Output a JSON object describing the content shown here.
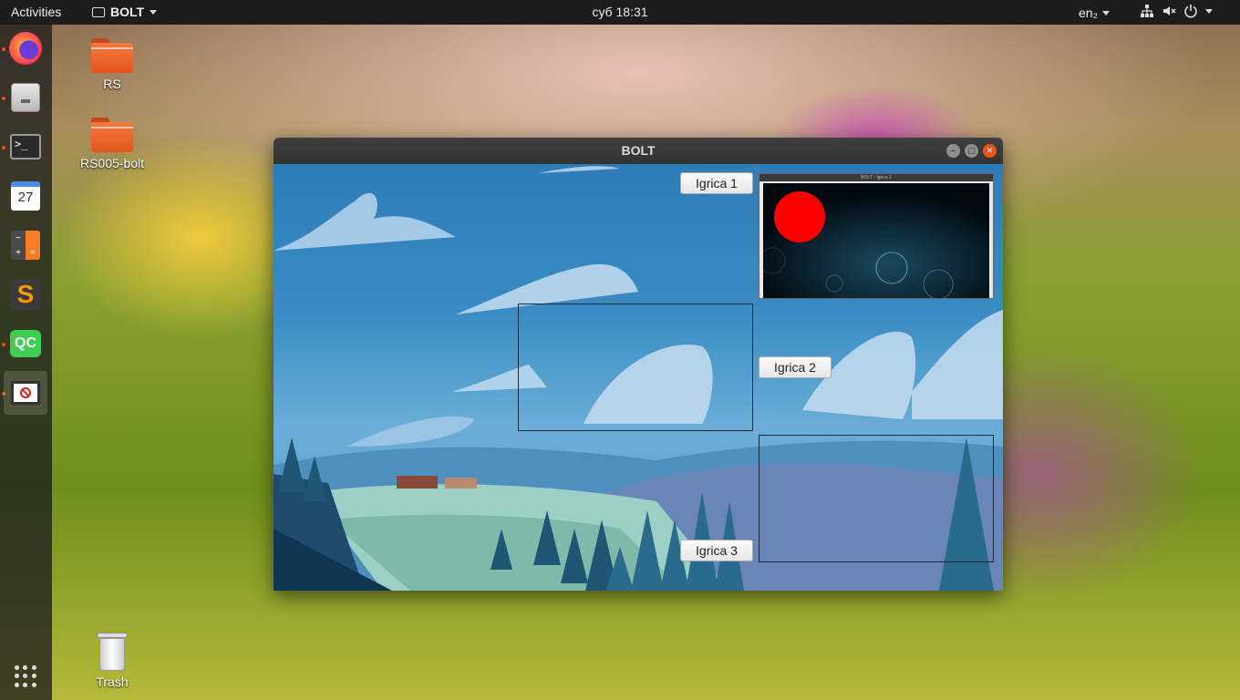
{
  "topbar": {
    "activities": "Activities",
    "app_name": "BOLT",
    "clock": "суб 18:31",
    "language": "en₂"
  },
  "dock": {
    "apps": [
      "firefox-icon",
      "files-icon",
      "terminal-icon",
      "calendar-icon",
      "calculator-icon",
      "sublime-text-icon",
      "qt-creator-icon",
      "bolt-app-icon"
    ],
    "calendar_day": "27",
    "terminal_prompt": ">_",
    "qc_label": "QC",
    "sublime_label": "S",
    "accent": "#e95420"
  },
  "desktop": {
    "icons": [
      {
        "label": "RS",
        "type": "folder"
      },
      {
        "label": "RS005-bolt",
        "type": "folder"
      },
      {
        "label": "Trash",
        "type": "trash"
      }
    ]
  },
  "window": {
    "title": "BOLT",
    "buttons": {
      "igrica1": "Igrica 1",
      "igrica2": "Igrica 2",
      "igrica3": "Igrica 3"
    },
    "preview_title": "BOLT - Igrica 1"
  }
}
